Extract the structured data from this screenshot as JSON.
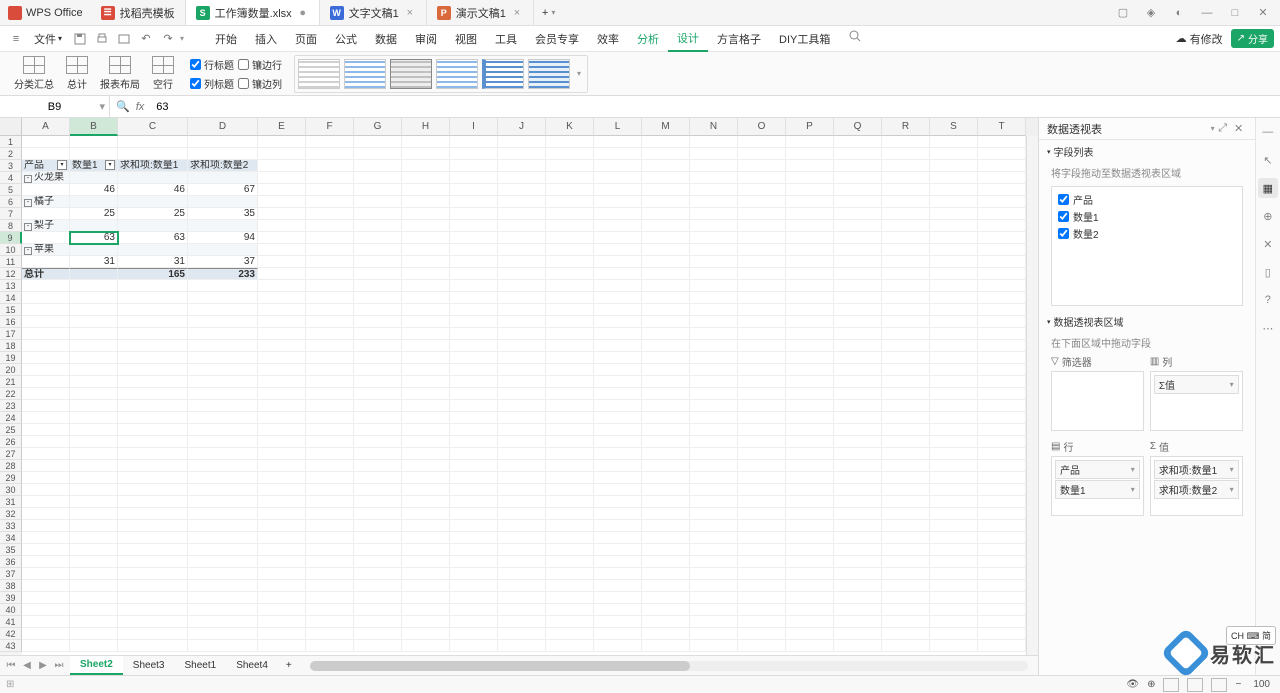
{
  "app": {
    "name": "WPS Office",
    "tabs": [
      {
        "icon": "doc",
        "label": "找稻壳模板",
        "active": false
      },
      {
        "icon": "xls",
        "label": "工作簿数量.xlsx",
        "active": true,
        "closable": true
      },
      {
        "icon": "docx",
        "label": "文字文稿1",
        "active": false,
        "closable": true
      },
      {
        "icon": "ppt",
        "label": "演示文稿1",
        "active": false,
        "closable": true
      }
    ],
    "window_icons": [
      "min",
      "max",
      "close"
    ],
    "extra_icons": [
      "layout",
      "cube",
      "globe"
    ]
  },
  "menu": {
    "file": "文件",
    "items": [
      "开始",
      "插入",
      "页面",
      "公式",
      "数据",
      "审阅",
      "视图",
      "工具",
      "会员专享",
      "效率"
    ],
    "analysis": "分析",
    "design": "设计",
    "extra": [
      "方言格子",
      "DIY工具箱"
    ],
    "has_edit": "有修改",
    "share": "分享"
  },
  "ribbon": {
    "buttons": [
      {
        "label": "分类汇总"
      },
      {
        "label": "总计"
      },
      {
        "label": "报表布局"
      },
      {
        "label": "空行"
      }
    ],
    "checks": {
      "row_header": "行标题",
      "col_header": "列标题",
      "banded_row": "镶边行",
      "banded_col": "镶边列"
    }
  },
  "formula_bar": {
    "name_box": "B9",
    "fx": "fx",
    "value": "63"
  },
  "columns": [
    "A",
    "B",
    "C",
    "D",
    "E",
    "F",
    "G",
    "H",
    "I",
    "J",
    "K",
    "L",
    "M",
    "N",
    "O",
    "P",
    "Q",
    "R",
    "S",
    "T"
  ],
  "pivot": {
    "headers": {
      "product": "产品",
      "qty1": "数量1",
      "sum1": "求和项:数量1",
      "sum2": "求和项:数量2"
    },
    "rows": [
      {
        "name": "火龙果",
        "qty1": "46",
        "sum1": "46",
        "sum2": "67"
      },
      {
        "name": "橘子",
        "qty1": "25",
        "sum1": "25",
        "sum2": "35"
      },
      {
        "name": "梨子",
        "qty1": "63",
        "sum1": "63",
        "sum2": "94"
      },
      {
        "name": "苹果",
        "qty1": "31",
        "sum1": "31",
        "sum2": "37"
      }
    ],
    "total": {
      "label": "总计",
      "sum1": "165",
      "sum2": "233"
    }
  },
  "selected_cell": {
    "ref": "B9",
    "value": "63"
  },
  "sheet_tabs": {
    "active": "Sheet2",
    "list": [
      "Sheet2",
      "Sheet3",
      "Sheet1",
      "Sheet4"
    ]
  },
  "side_panel": {
    "title": "数据透视表",
    "fields_title": "字段列表",
    "fields_sub": "将字段拖动至数据透视表区域",
    "fields": [
      {
        "name": "产品",
        "checked": true
      },
      {
        "name": "数量1",
        "checked": true
      },
      {
        "name": "数量2",
        "checked": true
      }
    ],
    "areas_title": "数据透视表区域",
    "areas_sub": "在下面区域中拖动字段",
    "filter_label": "筛选器",
    "col_label": "列",
    "col_items": [
      "Σ值"
    ],
    "row_label": "行",
    "row_items": [
      "产品",
      "数量1"
    ],
    "val_label": "值",
    "val_items": [
      "求和项:数量1",
      "求和项:数量2"
    ]
  },
  "status": {
    "zoom": "100"
  },
  "ime": "CH ⌨ 简",
  "watermark": "易软汇"
}
